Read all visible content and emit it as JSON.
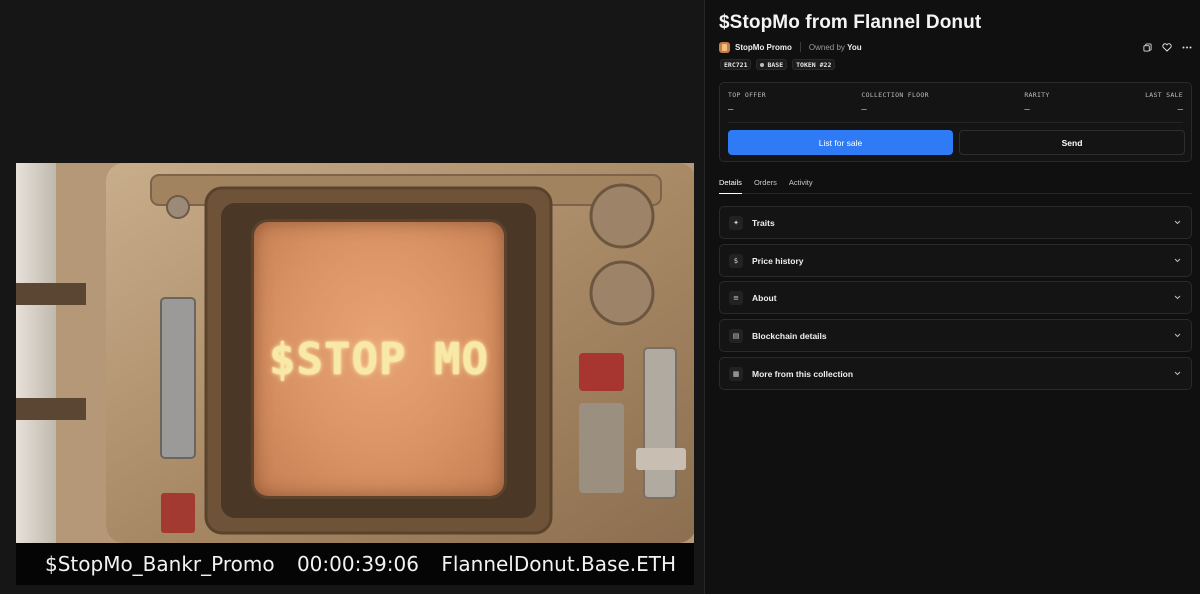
{
  "media": {
    "screen_text": "$STOP MO",
    "caption_left": "$StopMo_Bankr_Promo",
    "caption_center": "00:00:39:06",
    "caption_right": "FlannelDonut.Base.ETH"
  },
  "nft": {
    "title": "$StopMo from Flannel Donut",
    "collection_name": "StopMo Promo",
    "owned_by_label": "Owned by",
    "owner": "You"
  },
  "badges": {
    "standard": "ERC721",
    "chain": "BASE",
    "token": "TOKEN #22"
  },
  "stats": {
    "top_offer": {
      "label": "TOP OFFER",
      "value": "–"
    },
    "collection_floor": {
      "label": "COLLECTION FLOOR",
      "value": "–"
    },
    "rarity": {
      "label": "RARITY",
      "value": "–"
    },
    "last_sale": {
      "label": "LAST SALE",
      "value": "–"
    }
  },
  "actions": {
    "list_for_sale": "List for sale",
    "send": "Send"
  },
  "tabs": [
    {
      "label": "Details",
      "active": true
    },
    {
      "label": "Orders",
      "active": false
    },
    {
      "label": "Activity",
      "active": false
    }
  ],
  "sections": [
    {
      "title": "Traits",
      "icon": "sparkle-icon"
    },
    {
      "title": "Price history",
      "icon": "dollar-icon"
    },
    {
      "title": "About",
      "icon": "info-icon"
    },
    {
      "title": "Blockchain details",
      "icon": "table-icon"
    },
    {
      "title": "More from this collection",
      "icon": "grid-icon"
    }
  ],
  "colors": {
    "accent": "#2f7bf5",
    "background": "#101010",
    "screen": "#d99263"
  }
}
